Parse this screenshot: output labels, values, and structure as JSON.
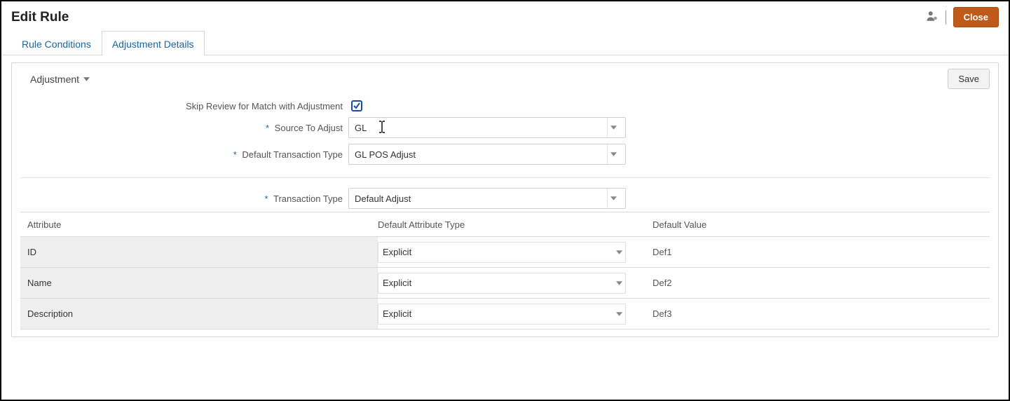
{
  "header": {
    "title": "Edit Rule",
    "close_label": "Close"
  },
  "tabs": {
    "conditions": "Rule Conditions",
    "details": "Adjustment Details"
  },
  "section": {
    "label": "Adjustment",
    "save_label": "Save"
  },
  "fields": {
    "skip_review_label": "Skip Review for Match with Adjustment",
    "skip_review_checked": true,
    "source_to_adjust_label": "Source To Adjust",
    "source_to_adjust_value": "GL",
    "default_txn_type_label": "Default Transaction Type",
    "default_txn_type_value": "GL POS Adjust",
    "txn_type_label": "Transaction Type",
    "txn_type_value": "Default Adjust"
  },
  "table": {
    "headers": {
      "attribute": "Attribute",
      "default_attr_type": "Default Attribute Type",
      "default_value": "Default Value"
    },
    "rows": [
      {
        "attribute": "ID",
        "type": "Explicit",
        "value": "Def1"
      },
      {
        "attribute": "Name",
        "type": "Explicit",
        "value": "Def2"
      },
      {
        "attribute": "Description",
        "type": "Explicit",
        "value": "Def3"
      }
    ]
  }
}
